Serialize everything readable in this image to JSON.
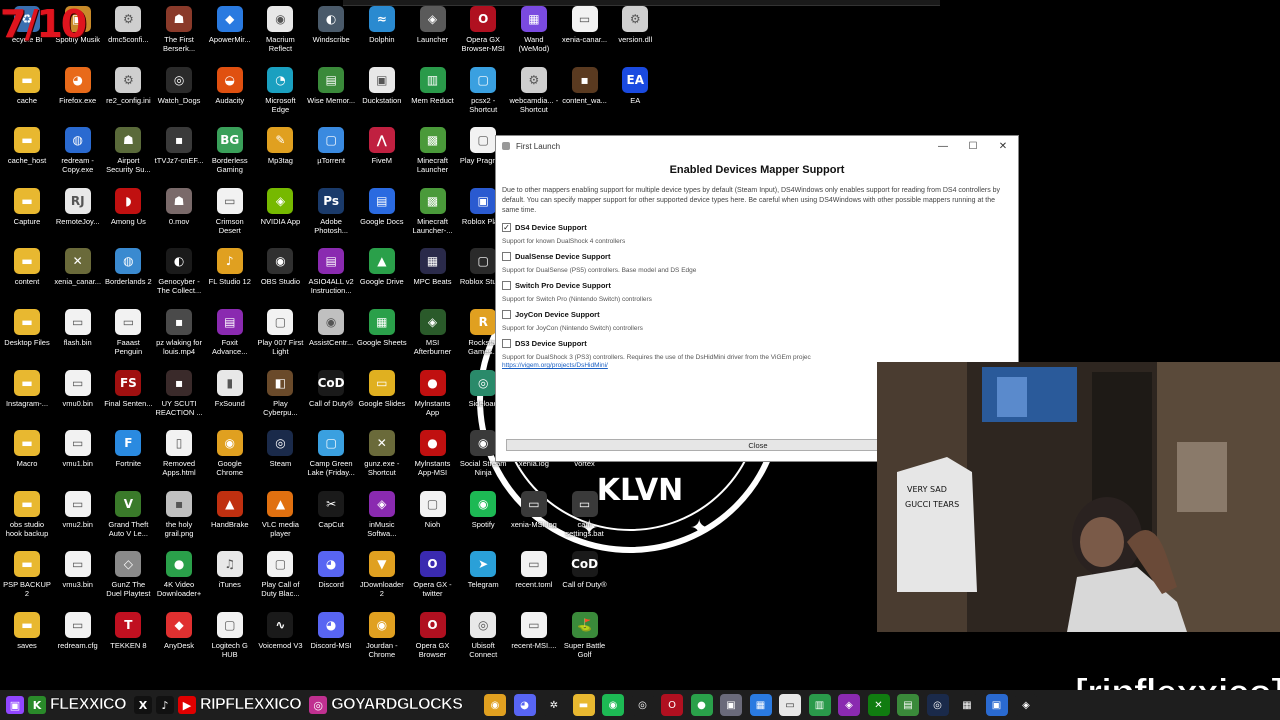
{
  "overlay_counter": "7/10",
  "desktop_icons": [
    {
      "label": "ecycle Bi",
      "glyph": "♻",
      "color": "#3a6fb0"
    },
    {
      "label": "Spotify Musik",
      "glyph": "▣",
      "color": "#c88a2a"
    },
    {
      "label": "dmc5confi...",
      "glyph": "⚙",
      "color": "#cfcfcf"
    },
    {
      "label": "The First Berserk...",
      "glyph": "☗",
      "color": "#8a3a2a"
    },
    {
      "label": "ApowerMir...",
      "glyph": "◆",
      "color": "#2a7ae0"
    },
    {
      "label": "Macrium Reflect",
      "glyph": "◉",
      "color": "#e8e8e8"
    },
    {
      "label": "Windscribe",
      "glyph": "◐",
      "color": "#4a5a6a"
    },
    {
      "label": "Dolphin",
      "glyph": "≈",
      "color": "#2a8ad0"
    },
    {
      "label": "Launcher",
      "glyph": "◈",
      "color": "#5a5a5a"
    },
    {
      "label": "Opera GX Browser-MSI",
      "glyph": "O",
      "color": "#b01020"
    },
    {
      "label": "Wand (WeMod)",
      "glyph": "▦",
      "color": "#7a4ae0"
    },
    {
      "label": "xenia-canar...",
      "glyph": "▭",
      "color": "#f2f2f2"
    },
    {
      "label": "version.dll",
      "glyph": "⚙",
      "color": "#cfcfcf"
    },
    {
      "label": "cache",
      "glyph": "▬",
      "color": "#e8b830"
    },
    {
      "label": "Firefox.exe",
      "glyph": "◕",
      "color": "#e86a1a"
    },
    {
      "label": "re2_config.ini",
      "glyph": "⚙",
      "color": "#cfcfcf"
    },
    {
      "label": "Watch_Dogs",
      "glyph": "◎",
      "color": "#2a2a2a"
    },
    {
      "label": "Audacity",
      "glyph": "◒",
      "color": "#e05010"
    },
    {
      "label": "Microsoft Edge",
      "glyph": "◔",
      "color": "#1aa0c0"
    },
    {
      "label": "Wise Memor...",
      "glyph": "▤",
      "color": "#3a8a3a"
    },
    {
      "label": "Duckstation",
      "glyph": "▣",
      "color": "#e8e8e8"
    },
    {
      "label": "Mem Reduct",
      "glyph": "▥",
      "color": "#2a9a4a"
    },
    {
      "label": "pcsx2 - Shortcut",
      "glyph": "▢",
      "color": "#3aa0e0"
    },
    {
      "label": "webcamdia... - Shortcut",
      "glyph": "⚙",
      "color": "#cfcfcf"
    },
    {
      "label": "content_wa...",
      "glyph": "▪",
      "color": "#5a3a20"
    },
    {
      "label": "EA",
      "glyph": "EA",
      "color": "#1a4ae0"
    },
    {
      "label": "cache_host",
      "glyph": "▬",
      "color": "#e8b830"
    },
    {
      "label": "redream - Copy.exe",
      "glyph": "◍",
      "color": "#2a6ad0"
    },
    {
      "label": "Airport Security Su...",
      "glyph": "☗",
      "color": "#5a6a3a"
    },
    {
      "label": "tTVJz7-cnEF...",
      "glyph": "▪",
      "color": "#3a3a3a"
    },
    {
      "label": "Borderless Gaming",
      "glyph": "BG",
      "color": "#3aa05a"
    },
    {
      "label": "Mp3tag",
      "glyph": "✎",
      "color": "#e0a020"
    },
    {
      "label": "µTorrent",
      "glyph": "▢",
      "color": "#3a8ae0"
    },
    {
      "label": "FiveM",
      "glyph": "⋀",
      "color": "#c02040"
    },
    {
      "label": "Minecraft Launcher",
      "glyph": "▩",
      "color": "#4a9a3a"
    },
    {
      "label": "Play Pragmati",
      "glyph": "▢",
      "color": "#f2f2f2"
    },
    {
      "label": "",
      "glyph": "",
      "color": "transparent"
    },
    {
      "label": "",
      "glyph": "",
      "color": "transparent"
    },
    {
      "label": "",
      "glyph": "",
      "color": "transparent"
    },
    {
      "label": "Capture",
      "glyph": "▬",
      "color": "#e8b830"
    },
    {
      "label": "RemoteJoy...",
      "glyph": "RJ",
      "color": "#e8e8e8"
    },
    {
      "label": "Among Us",
      "glyph": "◗",
      "color": "#c01010"
    },
    {
      "label": "0.mov",
      "glyph": "☗",
      "color": "#7a6a6a"
    },
    {
      "label": "Crimson Desert",
      "glyph": "▭",
      "color": "#f2f2f2"
    },
    {
      "label": "NVIDIA App",
      "glyph": "◈",
      "color": "#76b900"
    },
    {
      "label": "Adobe Photosh...",
      "glyph": "Ps",
      "color": "#1a3a6a"
    },
    {
      "label": "Google Docs",
      "glyph": "▤",
      "color": "#2a6ae0"
    },
    {
      "label": "Minecraft Launcher-...",
      "glyph": "▩",
      "color": "#4a9a3a"
    },
    {
      "label": "Roblox Pla...",
      "glyph": "▣",
      "color": "#2a5ad0"
    },
    {
      "label": "",
      "glyph": "",
      "color": "transparent"
    },
    {
      "label": "",
      "glyph": "",
      "color": "transparent"
    },
    {
      "label": "",
      "glyph": "",
      "color": "transparent"
    },
    {
      "label": "content",
      "glyph": "▬",
      "color": "#e8b830"
    },
    {
      "label": "xenia_canar...",
      "glyph": "✕",
      "color": "#6a6a3a"
    },
    {
      "label": "Borderlands 2",
      "glyph": "◍",
      "color": "#3a8ad0"
    },
    {
      "label": "Genocyber - The Collect...",
      "glyph": "◐",
      "color": "#1a1a1a"
    },
    {
      "label": "FL Studio 12",
      "glyph": "♪",
      "color": "#e0a020"
    },
    {
      "label": "OBS Studio",
      "glyph": "◉",
      "color": "#303030"
    },
    {
      "label": "ASIO4ALL v2 Instruction...",
      "glyph": "▤",
      "color": "#8a2ab0"
    },
    {
      "label": "Google Drive",
      "glyph": "▲",
      "color": "#2aa04a"
    },
    {
      "label": "MPC Beats",
      "glyph": "▦",
      "color": "#2a2a4a"
    },
    {
      "label": "Roblox Studio",
      "glyph": "▢",
      "color": "#2a2a2a"
    },
    {
      "label": "",
      "glyph": "",
      "color": "transparent"
    },
    {
      "label": "",
      "glyph": "",
      "color": "transparent"
    },
    {
      "label": "",
      "glyph": "",
      "color": "transparent"
    },
    {
      "label": "Desktop Files",
      "glyph": "▬",
      "color": "#e8b830"
    },
    {
      "label": "flash.bin",
      "glyph": "▭",
      "color": "#f2f2f2"
    },
    {
      "label": "Faaast Penguin",
      "glyph": "▭",
      "color": "#f2f2f2"
    },
    {
      "label": "pz wlaking for louis.mp4",
      "glyph": "▪",
      "color": "#4a4a4a"
    },
    {
      "label": "Foxit Advance...",
      "glyph": "▤",
      "color": "#8a2ab0"
    },
    {
      "label": "Play 007 First Light",
      "glyph": "▢",
      "color": "#f2f2f2"
    },
    {
      "label": "AssistCentr...",
      "glyph": "◉",
      "color": "#c0c0c0"
    },
    {
      "label": "Google Sheets",
      "glyph": "▦",
      "color": "#2aa04a"
    },
    {
      "label": "MSI Afterburner",
      "glyph": "◈",
      "color": "#2a5a2a"
    },
    {
      "label": "Rockstar Games...",
      "glyph": "R",
      "color": "#e0a020"
    },
    {
      "label": "",
      "glyph": "",
      "color": "transparent"
    },
    {
      "label": "",
      "glyph": "",
      "color": "transparent"
    },
    {
      "label": "",
      "glyph": "",
      "color": "transparent"
    },
    {
      "label": "Instagram-...",
      "glyph": "▬",
      "color": "#e8b830"
    },
    {
      "label": "vmu0.bin",
      "glyph": "▭",
      "color": "#f2f2f2"
    },
    {
      "label": "Final Senten...",
      "glyph": "FS",
      "color": "#a01010"
    },
    {
      "label": "UY SCUTI REACTION ...",
      "glyph": "▪",
      "color": "#3a2a2a"
    },
    {
      "label": "FxSound",
      "glyph": "▮",
      "color": "#e8e8e8"
    },
    {
      "label": "Play Cyberpu...",
      "glyph": "◧",
      "color": "#6a4a2a"
    },
    {
      "label": "Call of Duty®",
      "glyph": "CoD",
      "color": "#1a1a1a"
    },
    {
      "label": "Google Slides",
      "glyph": "▭",
      "color": "#e0b020"
    },
    {
      "label": "Mylnstants App",
      "glyph": "●",
      "color": "#c01010"
    },
    {
      "label": "Sideload",
      "glyph": "◎",
      "color": "#2a8a6a"
    },
    {
      "label": "",
      "glyph": "",
      "color": "transparent"
    },
    {
      "label": "",
      "glyph": "",
      "color": "transparent"
    },
    {
      "label": "",
      "glyph": "",
      "color": "transparent"
    },
    {
      "label": "Macro",
      "glyph": "▬",
      "color": "#e8b830"
    },
    {
      "label": "vmu1.bin",
      "glyph": "▭",
      "color": "#f2f2f2"
    },
    {
      "label": "Fortnite",
      "glyph": "F",
      "color": "#2a8ae0"
    },
    {
      "label": "Removed Apps.html",
      "glyph": "▯",
      "color": "#f2f2f2"
    },
    {
      "label": "Google Chrome",
      "glyph": "◉",
      "color": "#e0a020"
    },
    {
      "label": "Steam",
      "glyph": "◎",
      "color": "#1a2a4a"
    },
    {
      "label": "Camp Green Lake (Friday...",
      "glyph": "▢",
      "color": "#3aa0e0"
    },
    {
      "label": "gunz.exe - Shortcut",
      "glyph": "✕",
      "color": "#6a6a3a"
    },
    {
      "label": "Mylnstants App-MSI",
      "glyph": "●",
      "color": "#c01010"
    },
    {
      "label": "Social Stream Ninja",
      "glyph": "◉",
      "color": "#3a3a3a"
    },
    {
      "label": "xenia.log",
      "glyph": "▭",
      "color": "#3a3a3a"
    },
    {
      "label": "vortex",
      "glyph": "▭",
      "color": "#3a3a3a"
    },
    {
      "label": "",
      "glyph": "",
      "color": "transparent"
    },
    {
      "label": "obs studio hook backup",
      "glyph": "▬",
      "color": "#e8b830"
    },
    {
      "label": "vmu2.bin",
      "glyph": "▭",
      "color": "#f2f2f2"
    },
    {
      "label": "Grand Theft Auto V Le...",
      "glyph": "V",
      "color": "#3a7a2a"
    },
    {
      "label": "the holy grail.png",
      "glyph": "▪",
      "color": "#c0c0c0"
    },
    {
      "label": "HandBrake",
      "glyph": "▲",
      "color": "#c03010"
    },
    {
      "label": "VLC media player",
      "glyph": "▲",
      "color": "#e07010"
    },
    {
      "label": "CapCut",
      "glyph": "✂",
      "color": "#1a1a1a"
    },
    {
      "label": "inMusic Softwa...",
      "glyph": "◈",
      "color": "#8a2ab0"
    },
    {
      "label": "Nioh",
      "glyph": "▢",
      "color": "#f2f2f2"
    },
    {
      "label": "Spotify",
      "glyph": "◉",
      "color": "#1db954"
    },
    {
      "label": "xenia-MSI.log",
      "glyph": "▭",
      "color": "#3a3a3a"
    },
    {
      "label": "cam settings.bat",
      "glyph": "▭",
      "color": "#3a3a3a"
    },
    {
      "label": "",
      "glyph": "",
      "color": "transparent"
    },
    {
      "label": "PSP BACKUP 2",
      "glyph": "▬",
      "color": "#e8b830"
    },
    {
      "label": "vmu3.bin",
      "glyph": "▭",
      "color": "#f2f2f2"
    },
    {
      "label": "GunZ The Duel Playtest",
      "glyph": "◇",
      "color": "#8a8a8a"
    },
    {
      "label": "4K Video Downloader+",
      "glyph": "●",
      "color": "#2aa04a"
    },
    {
      "label": "iTunes",
      "glyph": "♫",
      "color": "#e8e8e8"
    },
    {
      "label": "Play Call of Duty Blac...",
      "glyph": "▢",
      "color": "#f2f2f2"
    },
    {
      "label": "Discord",
      "glyph": "◕",
      "color": "#5865f2"
    },
    {
      "label": "JDownloader 2",
      "glyph": "▼",
      "color": "#e0a020"
    },
    {
      "label": "Opera GX - twitter",
      "glyph": "O",
      "color": "#3a2ab0"
    },
    {
      "label": "Telegram",
      "glyph": "➤",
      "color": "#2aa0d8"
    },
    {
      "label": "recent.toml",
      "glyph": "▭",
      "color": "#f2f2f2"
    },
    {
      "label": "Call of Duty®",
      "glyph": "CoD",
      "color": "#1a1a1a"
    },
    {
      "label": "",
      "glyph": "",
      "color": "transparent"
    },
    {
      "label": "saves",
      "glyph": "▬",
      "color": "#e8b830"
    },
    {
      "label": "redream.cfg",
      "glyph": "▭",
      "color": "#f2f2f2"
    },
    {
      "label": "TEKKEN 8",
      "glyph": "T",
      "color": "#c01020"
    },
    {
      "label": "AnyDesk",
      "glyph": "◆",
      "color": "#e03030"
    },
    {
      "label": "Logitech G HUB",
      "glyph": "▢",
      "color": "#f2f2f2"
    },
    {
      "label": "Voicemod V3",
      "glyph": "∿",
      "color": "#1a1a1a"
    },
    {
      "label": "Discord-MSI",
      "glyph": "◕",
      "color": "#5865f2"
    },
    {
      "label": "Jourdan - Chrome",
      "glyph": "◉",
      "color": "#e0a020"
    },
    {
      "label": "Opera GX Browser",
      "glyph": "O",
      "color": "#b01020"
    },
    {
      "label": "Ubisoft Connect",
      "glyph": "◎",
      "color": "#e8e8e8"
    },
    {
      "label": "recent-MSI....",
      "glyph": "▭",
      "color": "#f2f2f2"
    },
    {
      "label": "Super Battle Golf",
      "glyph": "⛳",
      "color": "#3a8a3a"
    },
    {
      "label": "",
      "glyph": "",
      "color": "transparent"
    }
  ],
  "dialog": {
    "title": "First Launch",
    "heading": "Enabled Devices Mapper Support",
    "description": "Due to other mappers enabling support for multiple device types by default (Steam Input), DS4Windows only enables support for reading from DS4 controllers by default. You can specify mapper support for other supported device types here. Be careful when using DS4Windows with other possible mappers running at the same time.",
    "options": [
      {
        "title": "DS4 Device Support",
        "desc": "Support for known DualShock 4 controllers",
        "checked": true
      },
      {
        "title": "DualSense Device Support",
        "desc": "Support for DualSense (PS5) controllers. Base model and DS Edge",
        "checked": false
      },
      {
        "title": "Switch Pro Device Support",
        "desc": "Support for Switch Pro (Nintendo Switch) controllers",
        "checked": false
      },
      {
        "title": "JoyCon Device Support",
        "desc": "Support for JoyCon (Nintendo Switch) controllers",
        "checked": false
      },
      {
        "title": "DS3 Device Support",
        "desc": "Support for DualShock 3 (PS3) controllers. Requires the use of the DsHidMini driver from the ViGEm projec",
        "checked": false
      }
    ],
    "link": "https://vigem.org/projects/DsHidMini/",
    "close_label": "Close",
    "minimize_glyph": "—",
    "maximize_glyph": "☐",
    "close_glyph": "✕"
  },
  "background_logo_text": "KLVN",
  "banner_text": "[ripflexxico]",
  "taskbar": {
    "social": [
      {
        "icon": "twitch-icon",
        "glyph": "▣",
        "color": "#9146ff"
      },
      {
        "icon": "kick-icon",
        "glyph": "K",
        "color": "#2a8a2a"
      },
      {
        "text": "FLEXXICO"
      },
      {
        "icon": "x-icon",
        "glyph": "X",
        "color": "#111111"
      },
      {
        "icon": "tiktok-icon",
        "glyph": "♪",
        "color": "#111111"
      },
      {
        "icon": "youtube-icon",
        "glyph": "▶",
        "color": "#e00000"
      },
      {
        "text": "RIPFLEXXICO"
      },
      {
        "icon": "instagram-icon",
        "glyph": "◎",
        "color": "#c03090"
      },
      {
        "text": "GOYARDGLOCKS"
      }
    ],
    "apps": [
      {
        "icon": "chrome-icon",
        "glyph": "◉",
        "color": "#e0a020"
      },
      {
        "icon": "discord-icon",
        "glyph": "◕",
        "color": "#5865f2"
      },
      {
        "icon": "chatgpt-icon",
        "glyph": "✲",
        "color": "#1e1e1e"
      },
      {
        "icon": "file-explorer-icon",
        "glyph": "▬",
        "color": "#e8b830"
      },
      {
        "icon": "spotify-icon",
        "glyph": "◉",
        "color": "#1db954"
      },
      {
        "icon": "obs-icon",
        "glyph": "◎",
        "color": "#1e1e1e"
      },
      {
        "icon": "opera-gx-icon",
        "glyph": "O",
        "color": "#b01020"
      },
      {
        "icon": "4k-video-icon",
        "glyph": "●",
        "color": "#2aa04a"
      },
      {
        "icon": "app-icon-9",
        "glyph": "▣",
        "color": "#6a6a7a"
      },
      {
        "icon": "grid-icon",
        "glyph": "▦",
        "color": "#2a7ae0"
      },
      {
        "icon": "notepad-icon",
        "glyph": "▭",
        "color": "#e8e8e8"
      },
      {
        "icon": "app-icon-12",
        "glyph": "▥",
        "color": "#2a9a4a"
      },
      {
        "icon": "app-icon-13",
        "glyph": "◈",
        "color": "#8a2ab0"
      },
      {
        "icon": "xbox-icon",
        "glyph": "✕",
        "color": "#107c10"
      },
      {
        "icon": "app-icon-15",
        "glyph": "▤",
        "color": "#3a8a3a"
      },
      {
        "icon": "steam-icon",
        "glyph": "◎",
        "color": "#1a2a4a"
      },
      {
        "icon": "app-icon-17",
        "glyph": "▦",
        "color": "#1e1e1e"
      },
      {
        "icon": "app-icon-18",
        "glyph": "▣",
        "color": "#2a6ad0"
      },
      {
        "icon": "ds4windows-icon",
        "glyph": "◈",
        "color": "#1e1e1e"
      }
    ]
  }
}
